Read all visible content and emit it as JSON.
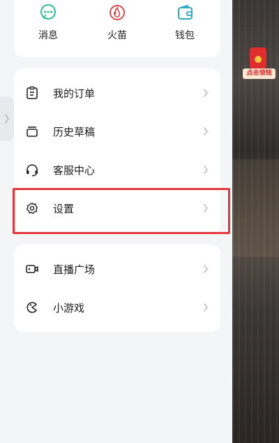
{
  "top_tiles": [
    {
      "label": "消息",
      "icon": "message-icon",
      "color": "#27c08e"
    },
    {
      "label": "火苗",
      "icon": "flame-icon",
      "color": "#e14a4a"
    },
    {
      "label": "钱包",
      "icon": "wallet-icon",
      "color": "#2fa8c6"
    }
  ],
  "menu": [
    {
      "label": "我的订单",
      "icon": "order-icon"
    },
    {
      "label": "历史草稿",
      "icon": "draft-icon"
    },
    {
      "label": "客服中心",
      "icon": "headset-icon"
    },
    {
      "label": "设置",
      "icon": "gear-icon"
    }
  ],
  "menu2": [
    {
      "label": "直播广场",
      "icon": "live-camera-icon"
    },
    {
      "label": "小游戏",
      "icon": "game-icon"
    }
  ],
  "redpacket": {
    "label": "点击领钱"
  },
  "colors": {
    "highlight": "#e5373b",
    "text": "#1c1c1c"
  }
}
